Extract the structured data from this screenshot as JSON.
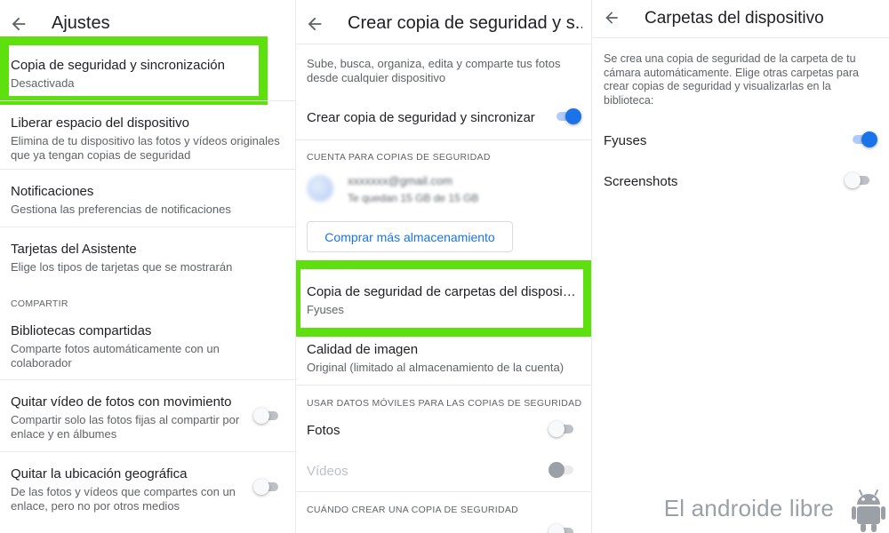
{
  "colors": {
    "accent": "#1a73e8",
    "highlight": "#5ee00f",
    "divider": "#e8eaed"
  },
  "panel1": {
    "title": "Ajustes",
    "items": [
      {
        "title": "Copia de seguridad y sincronización",
        "subtitle": "Desactivada"
      },
      {
        "title": "Liberar espacio del dispositivo",
        "subtitle": "Elimina de tu dispositivo las fotos y vídeos originales que ya tengan copias de seguridad"
      },
      {
        "title": "Notificaciones",
        "subtitle": "Gestiona las preferencias de notificaciones"
      },
      {
        "title": "Tarjetas del Asistente",
        "subtitle": "Elige los tipos de tarjetas que se mostrarán"
      },
      {
        "title": "Bibliotecas compartidas",
        "subtitle": "Comparte fotos automáticamente con un colaborador"
      },
      {
        "title": "Quitar vídeo de fotos con movimiento",
        "subtitle": "Compartir solo las fotos fijas al compartir por enlace y en álbumes",
        "toggle": false
      },
      {
        "title": "Quitar la ubicación geográfica",
        "subtitle": "De las fotos y vídeos que compartes con un enlace, pero no por otros medios",
        "toggle": false
      }
    ],
    "section_compartir": "COMPARTIR"
  },
  "panel2": {
    "title": "Crear copia de seguridad y s...",
    "description": "Sube, busca, organiza, edita y comparte tus fotos desde cualquier dispositivo",
    "backup_toggle_label": "Crear copia de seguridad y sincronizar",
    "backup_toggle": true,
    "section_account": "CUENTA PARA COPIAS DE SEGURIDAD",
    "account_email": "xxxxxxx@gmail.com",
    "account_storage": "Te quedan 15 GB de 15 GB",
    "buy_storage_label": "Comprar más almacenamiento",
    "folders_title": "Copia de seguridad de carpetas del dispositiv...",
    "folders_subtitle": "Fyuses",
    "quality_title": "Calidad de imagen",
    "quality_subtitle": "Original (limitado al almacenamiento de la cuenta)",
    "section_mobile_data": "USAR DATOS MÓVILES PARA LAS COPIAS DE SEGURIDAD",
    "photos_label": "Fotos",
    "photos_toggle": false,
    "videos_label": "Vídeos",
    "videos_toggle": false,
    "section_when": "CUÁNDO CREAR UNA COPIA DE SEGURIDAD"
  },
  "panel3": {
    "title": "Carpetas del dispositivo",
    "description": "Se crea una copia de seguridad de la carpeta de tu cámara automáticamente. Elige otras carpetas para crear copias de seguridad y visualizarlas en la biblioteca:",
    "folders": [
      {
        "name": "Fyuses",
        "toggle": true
      },
      {
        "name": "Screenshots",
        "toggle": false
      }
    ]
  },
  "watermark": "El androide libre",
  "icons": {
    "back": "arrow-back-icon",
    "mascot": "android-robot-icon"
  }
}
